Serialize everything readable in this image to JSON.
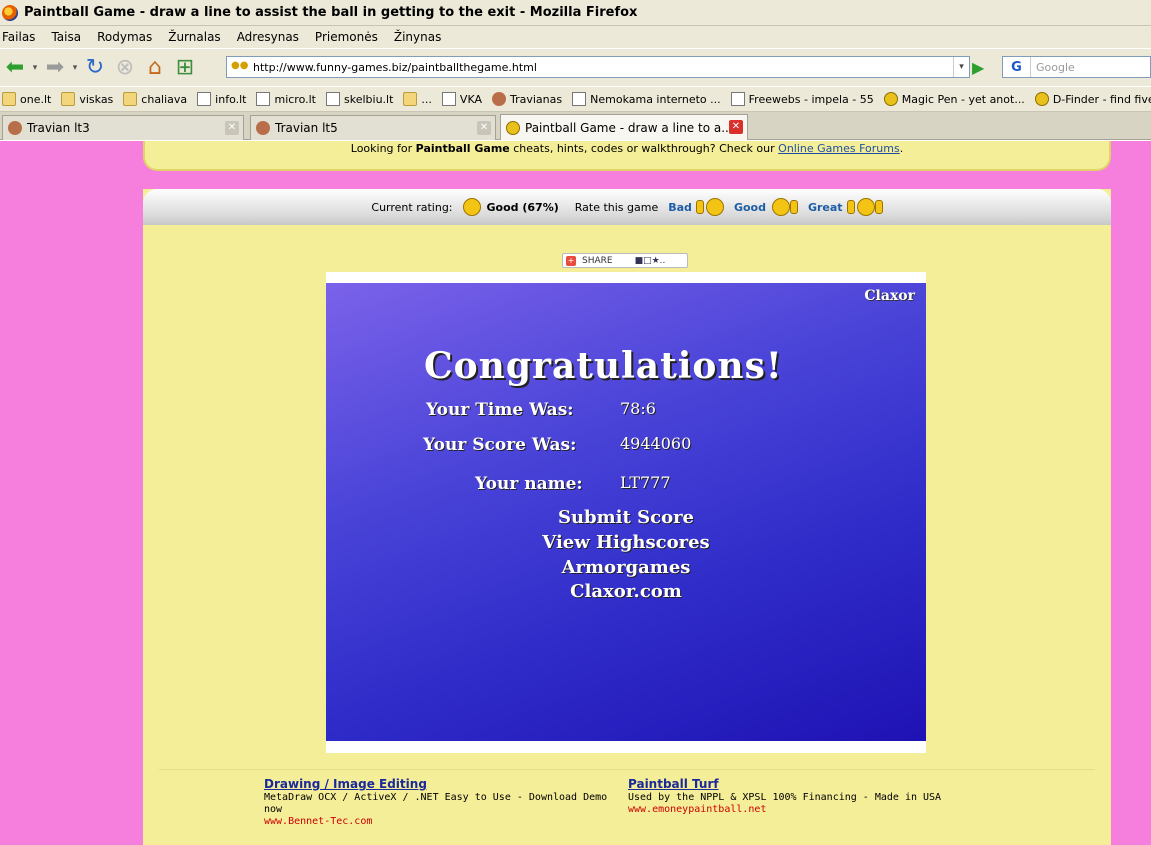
{
  "window": {
    "title": "Paintball Game - draw a line to assist the ball in getting to the exit - Mozilla Firefox"
  },
  "menu": [
    "Failas",
    "Taisa",
    "Rodymas",
    "Žurnalas",
    "Adresynas",
    "Priemonės",
    "Žinynas"
  ],
  "navbar": {
    "url": "http://www.funny-games.biz/paintballthegame.html",
    "search_placeholder": "Google"
  },
  "bookmarks": [
    {
      "label": "one.lt",
      "icon": "folder-icon"
    },
    {
      "label": "viskas",
      "icon": "folder-icon"
    },
    {
      "label": "chaliava",
      "icon": "folder-icon"
    },
    {
      "label": "info.lt",
      "icon": "page-icon"
    },
    {
      "label": "micro.lt",
      "icon": "page-icon"
    },
    {
      "label": "skelbiu.lt",
      "icon": "page-icon"
    },
    {
      "label": "...",
      "icon": "folder-icon"
    },
    {
      "label": "VKA",
      "icon": "page-icon"
    },
    {
      "label": "Travianas",
      "icon": "user-icon"
    },
    {
      "label": "Nemokama interneto ...",
      "icon": "page-icon"
    },
    {
      "label": "Freewebs - impela - 55",
      "icon": "page-icon"
    },
    {
      "label": "Magic Pen - yet anot...",
      "icon": "smile-icon"
    },
    {
      "label": "D-Finder - find five di...",
      "icon": "smile-icon"
    }
  ],
  "tabs": [
    {
      "label": "Travian lt3"
    },
    {
      "label": "Travian lt5"
    },
    {
      "label": "Paintball Game - draw a line to a..."
    }
  ],
  "notice": {
    "prefix": "Looking for ",
    "bold": "Paintball Game",
    "middle": " cheats, hints, codes or walkthrough? Check our ",
    "link": "Online Games Forums",
    "suffix": "."
  },
  "rating": {
    "current_label": "Current rating:",
    "current_value": "Good (67%)",
    "rate_label": "Rate this game",
    "bad": "Bad",
    "good": "Good",
    "great": "Great"
  },
  "share": {
    "label": "SHARE"
  },
  "game": {
    "brand": "Claxor",
    "headline": "Congratulations!",
    "time_label": "Your Time Was:",
    "time_value": "78:6",
    "score_label": "Your Score Was:",
    "score_value": "4944060",
    "name_label": "Your name:",
    "name_value": "LT777",
    "links": [
      "Submit Score",
      "View Highscores",
      "Armorgames",
      "Claxor.com"
    ]
  },
  "ads": [
    {
      "title": "Drawing / Image Editing",
      "text1": "MetaDraw OCX / ActiveX / .NET Easy to Use - Download Demo",
      "text2": "now",
      "url": "www.Bennet-Tec.com"
    },
    {
      "title": "Paintball Turf",
      "text1": "Used by the NPPL & XPSL 100% Financing - Made in USA",
      "text2": "",
      "url": "www.emoneypaintball.net"
    }
  ],
  "colors": {
    "page_background": "#f67fdd",
    "content_background": "#f5ee98",
    "game_gradient_top": "#7b62ea",
    "game_gradient_bottom": "#1f12b4",
    "link_blue": "#1e5ea8",
    "ad_url_red": "#cc0000"
  }
}
